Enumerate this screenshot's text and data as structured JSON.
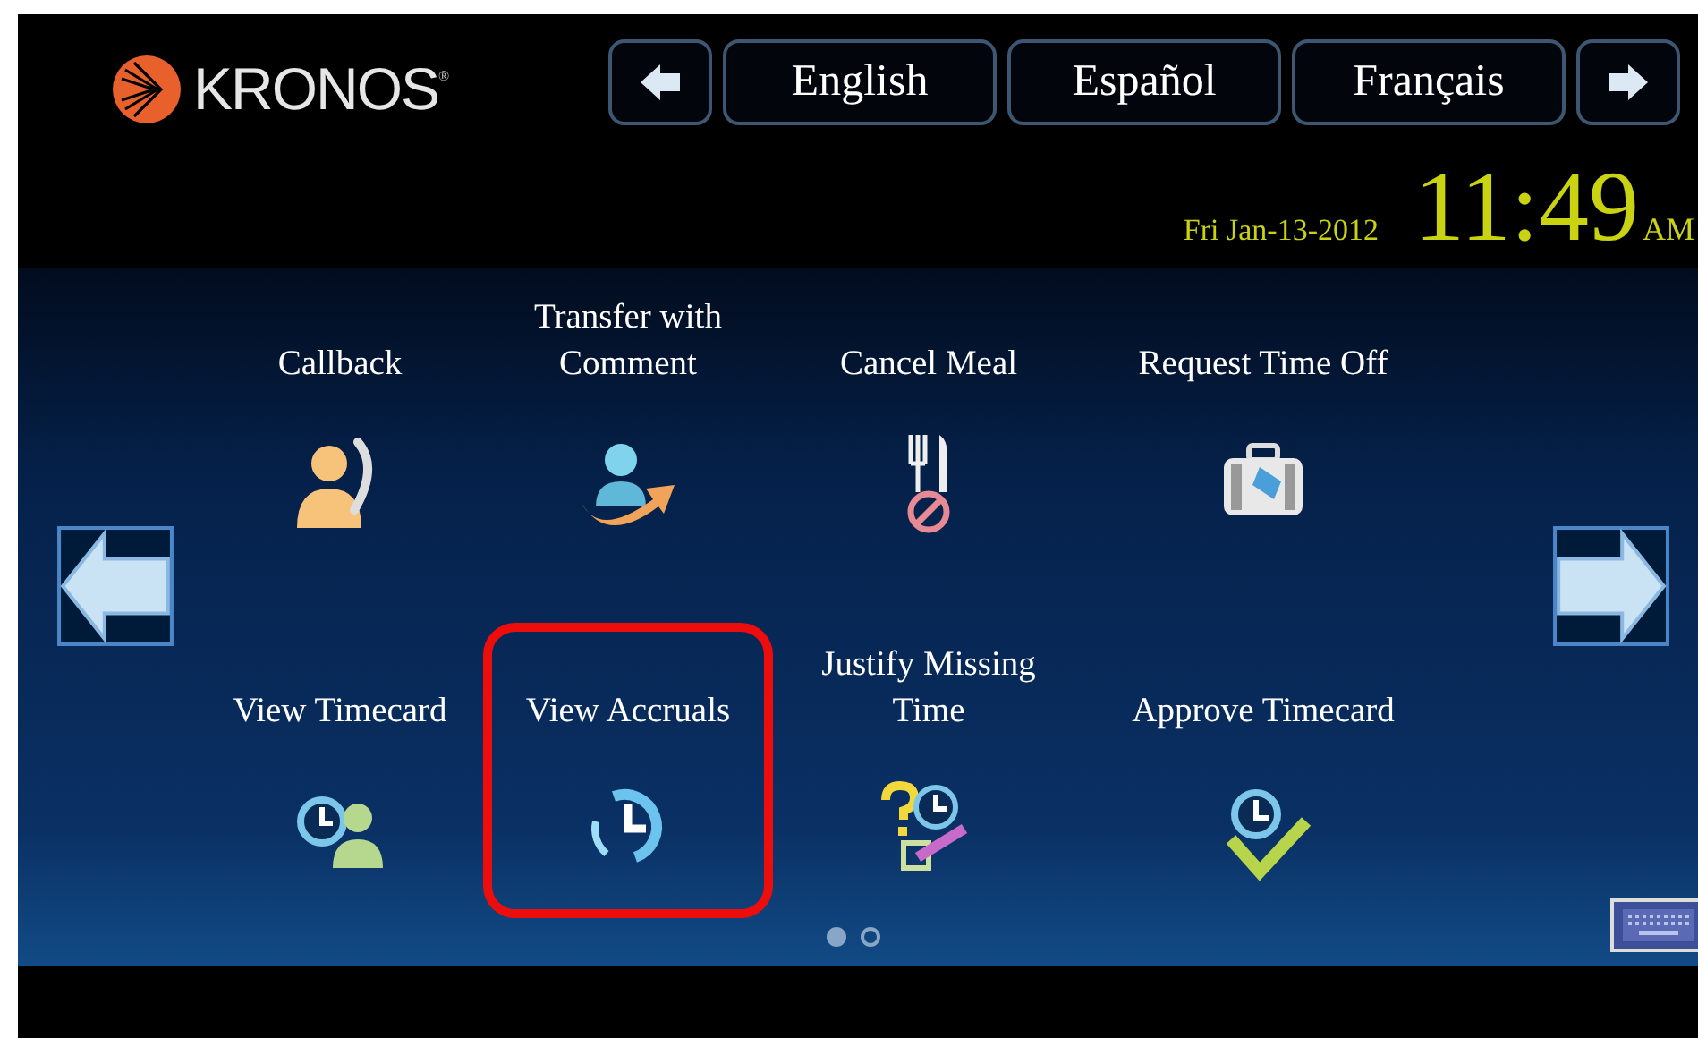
{
  "logo": {
    "text": "KRONOS",
    "mark": "®"
  },
  "languages": [
    {
      "label": "English"
    },
    {
      "label": "Español"
    },
    {
      "label": "Français"
    }
  ],
  "date": "Fri Jan-13-2012",
  "time": "11:49",
  "meridiem": "AM",
  "tiles": [
    {
      "label": "Callback",
      "kind": "callback",
      "highlighted": false
    },
    {
      "label": "Transfer with Comment",
      "kind": "transfer",
      "highlighted": false
    },
    {
      "label": "Cancel Meal",
      "kind": "cancel-meal",
      "highlighted": false
    },
    {
      "label": "Request Time Off",
      "kind": "time-off",
      "highlighted": false
    },
    {
      "label": "View Timecard",
      "kind": "timecard",
      "highlighted": false
    },
    {
      "label": "View Accruals",
      "kind": "accruals",
      "highlighted": true
    },
    {
      "label": "Justify Missing Time",
      "kind": "justify",
      "highlighted": false
    },
    {
      "label": "Approve Timecard",
      "kind": "approve",
      "highlighted": false
    }
  ],
  "pages": [
    {
      "selected": true
    },
    {
      "selected": false
    }
  ]
}
